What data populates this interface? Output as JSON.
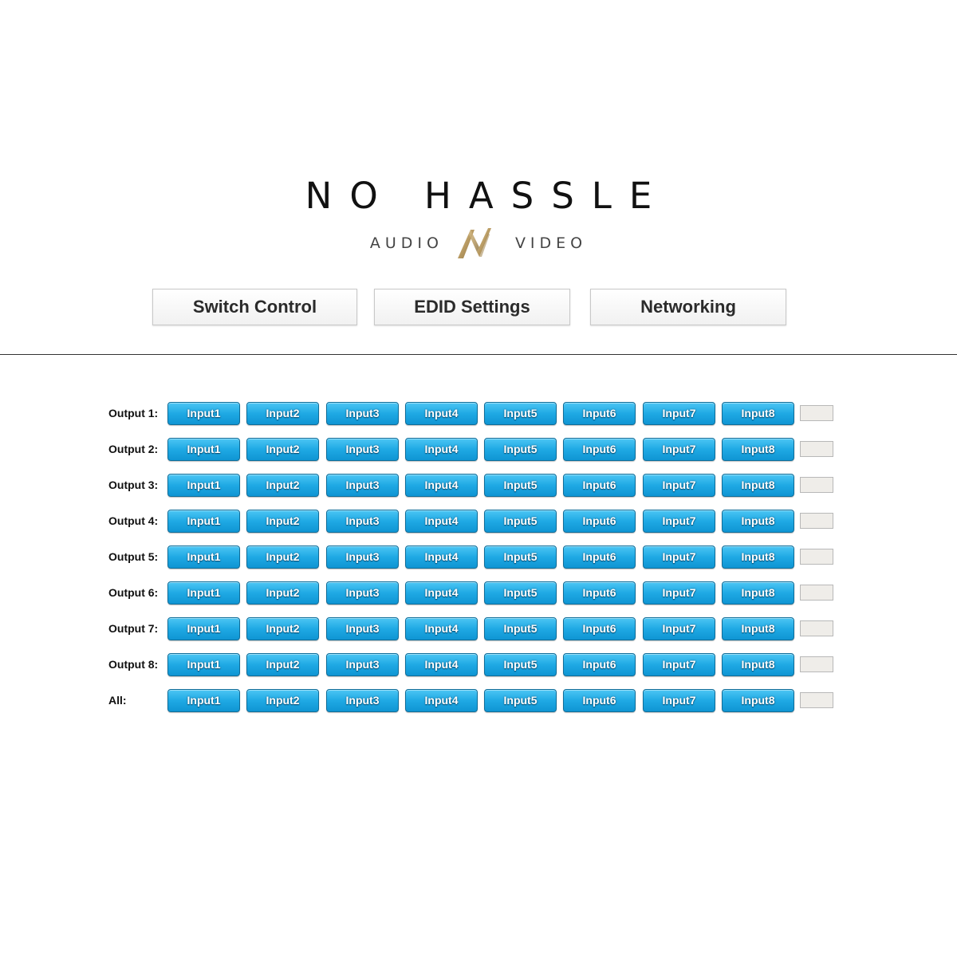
{
  "logo": {
    "title": "NO HASSLE",
    "left_word": "AUDIO",
    "right_word": "VIDEO",
    "mark": "AV",
    "mark_color": "#b89a62"
  },
  "nav": {
    "items": [
      {
        "label": "Switch Control"
      },
      {
        "label": "EDID Settings"
      },
      {
        "label": "Networking"
      }
    ]
  },
  "matrix": {
    "button_color": "#1fa9e4",
    "inputs": [
      "Input1",
      "Input2",
      "Input3",
      "Input4",
      "Input5",
      "Input6",
      "Input7",
      "Input8"
    ],
    "rows": [
      {
        "label": "Output 1:",
        "status": ""
      },
      {
        "label": "Output 2:",
        "status": ""
      },
      {
        "label": "Output 3:",
        "status": ""
      },
      {
        "label": "Output 4:",
        "status": ""
      },
      {
        "label": "Output 5:",
        "status": ""
      },
      {
        "label": "Output 6:",
        "status": ""
      },
      {
        "label": "Output 7:",
        "status": ""
      },
      {
        "label": "Output 8:",
        "status": ""
      },
      {
        "label": "All:",
        "status": ""
      }
    ]
  }
}
